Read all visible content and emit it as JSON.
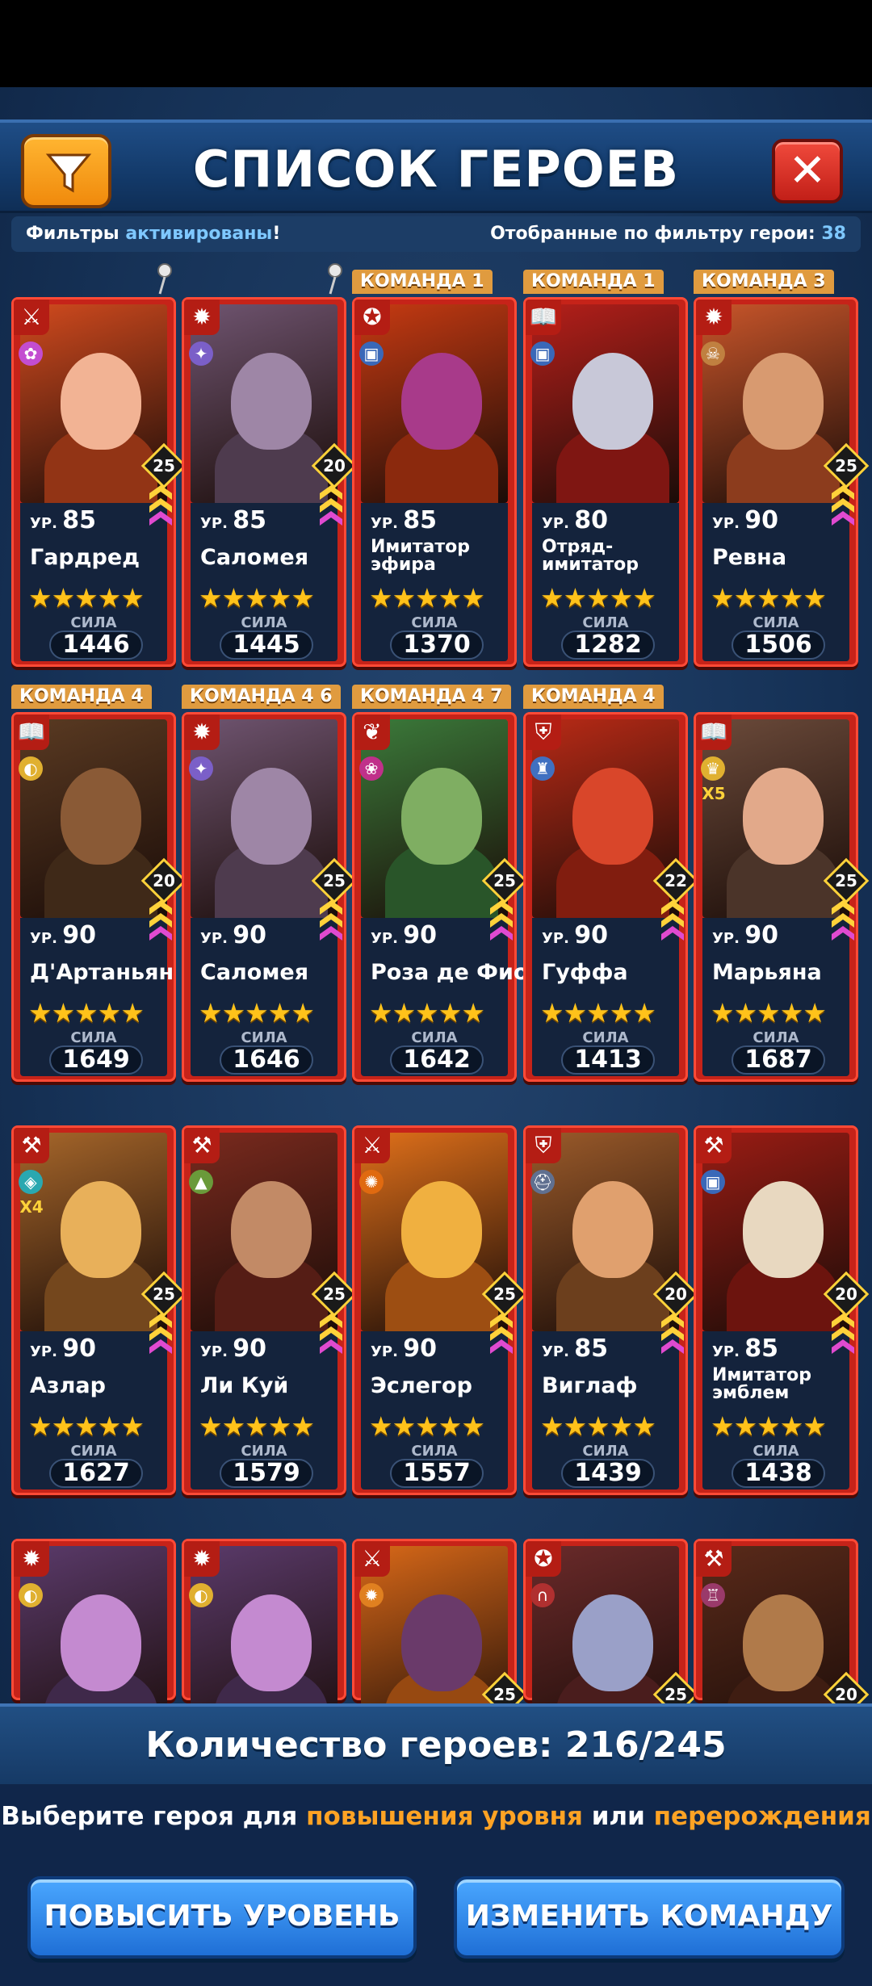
{
  "header": {
    "title": "СПИСОК ГЕРОЕВ",
    "filter_icon": "filter-icon",
    "close_icon": "close-icon",
    "close_label": "✕"
  },
  "info": {
    "filters_prefix": "Фильтры ",
    "filters_status": "активированы",
    "filters_suffix": "!",
    "selected_label": "Отобранные по фильтру герои: ",
    "selected_count": "38"
  },
  "heroes": [
    {
      "team": "",
      "pinned": true,
      "level_prefix": "УР.",
      "level": "85",
      "name": "Гардред",
      "power_label": "СИЛА",
      "power": "1446",
      "rank": "25",
      "class_icon": "swords-icon",
      "element_icon": "fairy-icon",
      "portrait": "#d14a1e",
      "face": "#f2b394"
    },
    {
      "team": "",
      "pinned": true,
      "level_prefix": "УР.",
      "level": "85",
      "name": "Саломея",
      "power_label": "СИЛА",
      "power": "1445",
      "rank": "20",
      "class_icon": "sun-icon",
      "element_icon": "star-icon",
      "portrait": "#6f5470",
      "face": "#9e86a6"
    },
    {
      "team": "КОМАНДА 1",
      "pinned": false,
      "level_prefix": "УР.",
      "level": "85",
      "name": "Имитатор эфира",
      "power_label": "СИЛА",
      "power": "1370",
      "rank": "",
      "class_icon": "pentagram-icon",
      "element_icon": "mimic-icon",
      "portrait": "#c63a12",
      "face": "#a83a8a"
    },
    {
      "team": "КОМАНДА 1",
      "pinned": false,
      "level_prefix": "УР.",
      "level": "80",
      "name": "Отряд-имитатор",
      "power_label": "СИЛА",
      "power": "1282",
      "rank": "",
      "class_icon": "book-icon",
      "element_icon": "mimic-icon",
      "portrait": "#b51f1a",
      "face": "#c8c8d8"
    },
    {
      "team": "КОМАНДА 3",
      "pinned": false,
      "level_prefix": "УР.",
      "level": "90",
      "name": "Ревна",
      "power_label": "СИЛА",
      "power": "1506",
      "rank": "25",
      "class_icon": "sun-icon",
      "element_icon": "skull-icon",
      "portrait": "#c8552a",
      "face": "#d89a70"
    },
    {
      "team": "КОМАНДА 4",
      "pinned": false,
      "level_prefix": "УР.",
      "level": "90",
      "name": "Д'Артаньян",
      "power_label": "СИЛА",
      "power": "1649",
      "rank": "20",
      "class_icon": "book-icon",
      "element_icon": "mask-icon",
      "portrait": "#5a3a22",
      "face": "#8a5a36"
    },
    {
      "team": "КОМАНДА 4 6",
      "pinned": false,
      "level_prefix": "УР.",
      "level": "90",
      "name": "Саломея",
      "power_label": "СИЛА",
      "power": "1646",
      "rank": "25",
      "class_icon": "sun-icon",
      "element_icon": "star-icon",
      "portrait": "#6f5470",
      "face": "#9e86a6"
    },
    {
      "team": "КОМАНДА 4 7",
      "pinned": false,
      "level_prefix": "УР.",
      "level": "90",
      "name": "Роза де Фио",
      "power_label": "СИЛА",
      "power": "1642",
      "rank": "25",
      "class_icon": "leaf-icon",
      "element_icon": "rose-icon",
      "portrait": "#3b7a3a",
      "face": "#7fae62"
    },
    {
      "team": "КОМАНДА 4",
      "pinned": false,
      "level_prefix": "УР.",
      "level": "90",
      "name": "Гуффа",
      "power_label": "СИЛА",
      "power": "1413",
      "rank": "22",
      "class_icon": "shield-icon",
      "element_icon": "tower-icon",
      "portrait": "#b82a16",
      "face": "#d9462a"
    },
    {
      "team": "",
      "pinned": false,
      "level_prefix": "УР.",
      "level": "90",
      "name": "Марьяна",
      "power_label": "СИЛА",
      "power": "1687",
      "rank": "25",
      "class_icon": "book-icon",
      "element_icon": "trophy-icon",
      "extra": "X5",
      "portrait": "#6b4a3a",
      "face": "#e2a98a"
    },
    {
      "team": "",
      "pinned": false,
      "level_prefix": "УР.",
      "level": "90",
      "name": "Азлар",
      "power_label": "СИЛА",
      "power": "1627",
      "rank": "25",
      "class_icon": "hammer-icon",
      "element_icon": "emblem-icon",
      "extra": "X4",
      "portrait": "#a6662a",
      "face": "#e8b05a"
    },
    {
      "team": "",
      "pinned": false,
      "level_prefix": "УР.",
      "level": "90",
      "name": "Ли Куй",
      "power_label": "СИЛА",
      "power": "1579",
      "rank": "25",
      "class_icon": "hammer-icon",
      "element_icon": "hat-icon",
      "portrait": "#7a2a1e",
      "face": "#c28a66"
    },
    {
      "team": "",
      "pinned": false,
      "level_prefix": "УР.",
      "level": "90",
      "name": "Эслегор",
      "power_label": "СИЛА",
      "power": "1557",
      "rank": "25",
      "class_icon": "swords-icon",
      "element_icon": "fire-icon",
      "portrait": "#e0701a",
      "face": "#f0b040"
    },
    {
      "team": "",
      "pinned": false,
      "level_prefix": "УР.",
      "level": "85",
      "name": "Виглаф",
      "power_label": "СИЛА",
      "power": "1439",
      "rank": "20",
      "class_icon": "shield-icon",
      "element_icon": "helmet-icon",
      "portrait": "#9a5a2a",
      "face": "#e0a06e"
    },
    {
      "team": "",
      "pinned": false,
      "level_prefix": "УР.",
      "level": "85",
      "name": "Имитатор эмблем",
      "power_label": "СИЛА",
      "power": "1438",
      "rank": "20",
      "class_icon": "hammer-icon",
      "element_icon": "mimic-icon",
      "portrait": "#9a1c14",
      "face": "#e8d8c0"
    },
    {
      "team": "",
      "pinned": false,
      "level_prefix": "",
      "level": "",
      "name": "",
      "power_label": "",
      "power": "",
      "rank": "",
      "class_icon": "sun-icon",
      "element_icon": "mask-icon",
      "portrait": "#5a3a6a",
      "face": "#c48ad0"
    },
    {
      "team": "",
      "pinned": false,
      "level_prefix": "",
      "level": "",
      "name": "",
      "power_label": "",
      "power": "",
      "rank": "",
      "class_icon": "sun-icon",
      "element_icon": "mask-icon",
      "portrait": "#5a3a6a",
      "face": "#c48ad0"
    },
    {
      "team": "",
      "pinned": false,
      "level_prefix": "",
      "level": "",
      "name": "",
      "power_label": "",
      "power": "",
      "rank": "25",
      "class_icon": "swords-icon",
      "element_icon": "sun-icon",
      "portrait": "#d86818",
      "face": "#6a3a6a"
    },
    {
      "team": "",
      "pinned": false,
      "level_prefix": "",
      "level": "",
      "name": "",
      "power_label": "",
      "power": "",
      "rank": "25",
      "class_icon": "pentagram-icon",
      "element_icon": "horseshoe-icon",
      "portrait": "#6a2a2a",
      "face": "#9aa0c8"
    },
    {
      "team": "",
      "pinned": false,
      "level_prefix": "",
      "level": "",
      "name": "",
      "power_label": "",
      "power": "",
      "rank": "20",
      "class_icon": "hammer-icon",
      "element_icon": "castle-icon",
      "portrait": "#5a2a1a",
      "face": "#b07a4a"
    }
  ],
  "footer": {
    "count_label": "Количество героев: ",
    "count_value": "216/245",
    "hint_1": "Выберите героя для ",
    "hint_2": "повышения уровня",
    "hint_3": " или ",
    "hint_4": "перерождения",
    "level_up_button": "ПОВЫСИТЬ УРОВЕНЬ",
    "change_team_button": "ИЗМЕНИТЬ КОМАНДУ"
  }
}
